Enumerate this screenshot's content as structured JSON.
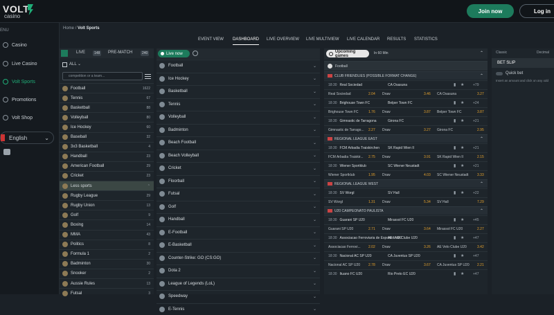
{
  "brand": {
    "logo_main": "VOLT",
    "logo_sub": "casino"
  },
  "header": {
    "join_label": "Join now",
    "login_label": "Log in"
  },
  "sidebar": {
    "section_label": "ENU",
    "items": [
      {
        "label": "Casino"
      },
      {
        "label": "Live Casino"
      },
      {
        "label": "Volt Sports"
      },
      {
        "label": "Promotions"
      },
      {
        "label": "Volt Shop"
      }
    ],
    "language": "English"
  },
  "breadcrumb": {
    "home": "Home",
    "sep": "/",
    "current": "Volt Sports"
  },
  "tabs": [
    "EVENT VIEW",
    "DASHBOARD",
    "LIVE OVERVIEW",
    "LIVE MULTIVIEW",
    "LIVE CALENDAR",
    "RESULTS",
    "STATISTICS"
  ],
  "col1": {
    "live_label": "LIVE",
    "live_count": "148",
    "prematch_label": "PRE-MATCH",
    "prematch_count": "240",
    "all_label": "ALL",
    "search_placeholder": "competition or a team...",
    "sports": [
      {
        "name": "Football",
        "count": "1622"
      },
      {
        "name": "Tennis",
        "count": "67"
      },
      {
        "name": "Basketball",
        "count": "88"
      },
      {
        "name": "Volleyball",
        "count": "80"
      },
      {
        "name": "Ice Hockey",
        "count": "60"
      },
      {
        "name": "Baseball",
        "count": "32"
      },
      {
        "name": "3x3 Basketball",
        "count": "4"
      },
      {
        "name": "Handball",
        "count": "23"
      },
      {
        "name": "American Football",
        "count": "29"
      },
      {
        "name": "Cricket",
        "count": "23"
      },
      {
        "name": "Less sports",
        "count": ""
      },
      {
        "name": "Rugby League",
        "count": "29"
      },
      {
        "name": "Rugby Union",
        "count": "13"
      },
      {
        "name": "Golf",
        "count": "9"
      },
      {
        "name": "Boxing",
        "count": "14"
      },
      {
        "name": "MMA",
        "count": "43"
      },
      {
        "name": "Politics",
        "count": "8"
      },
      {
        "name": "Formula 1",
        "count": "2"
      },
      {
        "name": "Badminton",
        "count": "30"
      },
      {
        "name": "Snooker",
        "count": "2"
      },
      {
        "name": "Aussie Rules",
        "count": "13"
      },
      {
        "name": "Futsal",
        "count": "3"
      }
    ]
  },
  "col2": {
    "title": "Live now",
    "sports": [
      "Football",
      "Ice Hockey",
      "Basketball",
      "Tennis",
      "Volleyball",
      "Badminton",
      "Beach Football",
      "Beach Volleyball",
      "Cricket",
      "Floorball",
      "Futsal",
      "Golf",
      "Handball",
      "E-Football",
      "E-Basketball",
      "Counter-Strike: GO (CS:GO)",
      "Dota 2",
      "League of Legends (LoL)",
      "Speedway",
      "E-Tennis"
    ]
  },
  "col3": {
    "title": "Upcoming games",
    "filter": "In 60 Min",
    "sport": "Football",
    "groups": [
      {
        "name": "CLUB FRIENDLIES (POSSIBLE FORMAT CHANGE)",
        "matches": [
          {
            "time": "18:30",
            "home": "Real Sociedad",
            "away": "CA Osasuna",
            "more": "+79",
            "o1": "2.04",
            "ox": "3.46",
            "o2": "3.27",
            "draw": "Draw"
          },
          {
            "time": "18:30",
            "home": "Brighouse Town FC",
            "away": "Belper Town FC",
            "more": "+24",
            "o1": "1.76",
            "ox": "3.87",
            "o2": "3.87",
            "draw": "Draw"
          },
          {
            "time": "18:30",
            "home": "Gimnastic de Tarragona",
            "away": "Girona FC",
            "more": "+21",
            "o1": "2.27",
            "ox": "3.27",
            "o2": "2.95",
            "draw": "Draw",
            "home_short": "Gimnastic de Tarrago..."
          }
        ]
      },
      {
        "name": "REGIONAL LEAGUE EAST",
        "matches": [
          {
            "time": "18:30",
            "home": "FCM Arbadia Traiskirchen",
            "away": "SK Rapid Wien II",
            "more": "+21",
            "o1": "2.75",
            "ox": "3.91",
            "o2": "2.15",
            "draw": "Draw",
            "home_short": "FCM Arbadia Traiskir..."
          },
          {
            "time": "18:30",
            "home": "Wiener Sportklub",
            "away": "SC Wiener Neustadt",
            "more": "+21",
            "o1": "1.95",
            "ox": "4.03",
            "o2": "3.33",
            "draw": "Draw"
          }
        ]
      },
      {
        "name": "REGIONAL LEAGUE WEST",
        "matches": [
          {
            "time": "18:30",
            "home": "SV Worgl",
            "away": "SV Hall",
            "more": "+22",
            "o1": "1.31",
            "ox": "5.34",
            "o2": "7.29",
            "draw": "Draw"
          }
        ]
      },
      {
        "name": "U20 CAMPEONATO PAULISTA",
        "matches": [
          {
            "time": "18:30",
            "home": "Guarani SP U20",
            "away": "Mirassol FC U20",
            "more": "+45",
            "o1": "2.71",
            "ox": "3.64",
            "o2": "2.27",
            "draw": "Draw"
          },
          {
            "time": "18:30",
            "home": "Associacao Ferroviaria de Esportes U20",
            "away": "AE Velo Clube U20",
            "more": "+47",
            "o1": "2.02",
            "ox": "3.26",
            "o2": "3.42",
            "draw": "Draw",
            "home_short": "Associacao Ferrovi...",
            "away_short": "AE Velo Clube U20"
          },
          {
            "time": "18:30",
            "home": "Nacional AC SP U20",
            "away": "CA Juventus SP U20",
            "more": "+47",
            "o1": "2.78",
            "ox": "3.67",
            "o2": "2.21",
            "draw": "Draw"
          },
          {
            "time": "18:30",
            "home": "Ituano FC U20",
            "away": "Rio Preto EC U20",
            "more": "+47",
            "o1": "",
            "ox": "",
            "o2": "",
            "draw": ""
          }
        ]
      }
    ]
  },
  "col4": {
    "odds_left": "Classic",
    "odds_right": "Decimal",
    "title": "BET SLIP",
    "quick_bet": "Quick bet",
    "hint": "Insert an amount and click on any odd"
  },
  "colors": {
    "accent": "#1d7b5c",
    "odds": "#e4a12d",
    "background": "#1b2127"
  }
}
